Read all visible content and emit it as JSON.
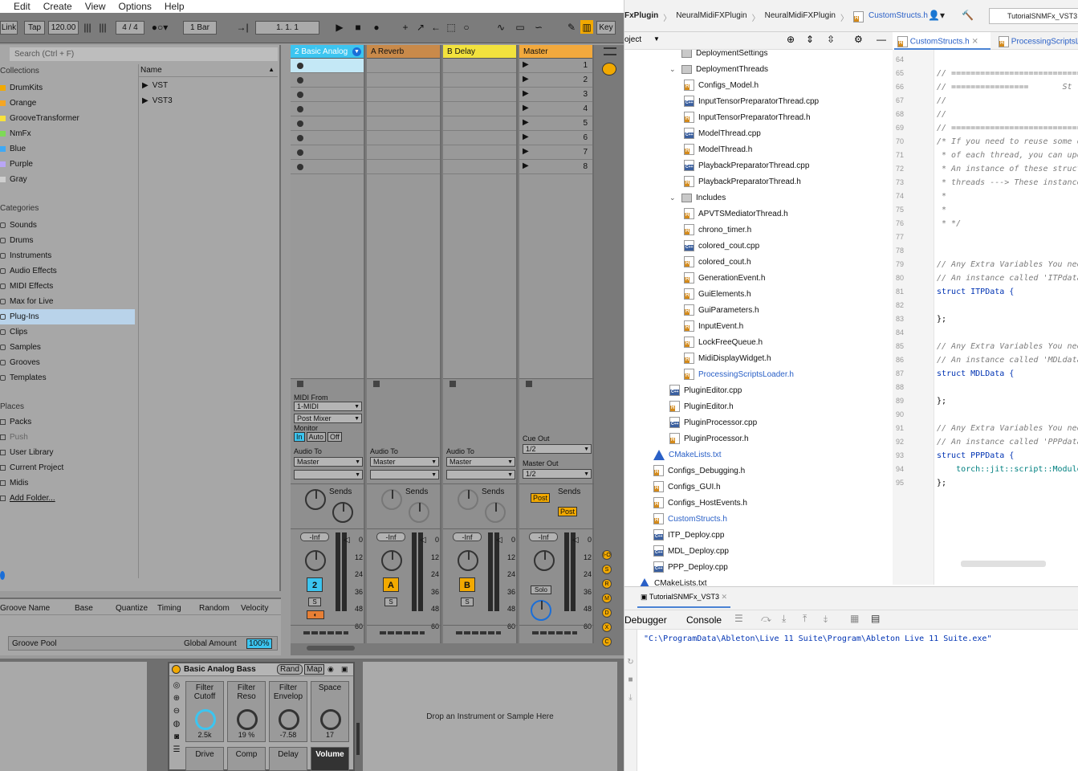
{
  "ableton": {
    "menu": [
      "Edit",
      "Create",
      "View",
      "Options",
      "Help"
    ],
    "transport": {
      "link": "Link",
      "tap": "Tap",
      "tempo": "120.00",
      "signature": "4 / 4",
      "quantize": "1 Bar",
      "position": "1.   1.   1",
      "key": "Key"
    },
    "browser": {
      "search_placeholder": "Search (Ctrl + F)",
      "collections_heading": "Collections",
      "collections": [
        {
          "label": "DrumKits",
          "color": "#f2a900"
        },
        {
          "label": "Orange",
          "color": "#f5a623"
        },
        {
          "label": "GrooveTransformer",
          "color": "#f7e13b"
        },
        {
          "label": "NmFx",
          "color": "#7ed957"
        },
        {
          "label": "Blue",
          "color": "#3fa9f5"
        },
        {
          "label": "Purple",
          "color": "#b9a6f5"
        },
        {
          "label": "Gray",
          "color": "#cfcfcf"
        }
      ],
      "categories_heading": "Categories",
      "categories": [
        "Sounds",
        "Drums",
        "Instruments",
        "Audio Effects",
        "MIDI Effects",
        "Max for Live",
        "Plug-Ins",
        "Clips",
        "Samples",
        "Grooves",
        "Templates"
      ],
      "places_heading": "Places",
      "places": [
        "Packs",
        "Push",
        "User Library",
        "Current Project",
        "Midis",
        "Add Folder..."
      ],
      "name_column": "Name",
      "name_items": [
        "VST",
        "VST3"
      ]
    },
    "groove": {
      "cols": [
        "Groove Name",
        "Base",
        "Quantize",
        "Timing",
        "Random",
        "Velocity"
      ],
      "pool": "Groove Pool",
      "global_amount_label": "Global Amount",
      "global_amount": "100%"
    },
    "tracks": [
      {
        "name": "2 Basic Analog",
        "color": "#3cc5f0",
        "number": "2",
        "send_a": "A",
        "send_b": "B",
        "vol": "-Inf"
      },
      {
        "name": "A Reverb",
        "color": "#c98a4a",
        "number": "A",
        "vol": "-Inf"
      },
      {
        "name": "B Delay",
        "color": "#f2e23d",
        "number": "B",
        "vol": "-Inf"
      },
      {
        "name": "Master",
        "color": "#f2a93d",
        "vol": "-Inf"
      }
    ],
    "scenes": [
      "1",
      "2",
      "3",
      "4",
      "5",
      "6",
      "7",
      "8"
    ],
    "io": {
      "midi_from": "MIDI From",
      "midi_from_val": "1-MIDI",
      "mixer_val": "Post Mixer",
      "monitor": "Monitor",
      "mon_in": "In",
      "mon_auto": "Auto",
      "mon_off": "Off",
      "audio_to": "Audio To",
      "master": "Master",
      "cue_out": "Cue Out",
      "cue_val": "1/2",
      "master_out": "Master Out",
      "master_out_val": "1/2"
    },
    "sends": "Sends",
    "post": "Post",
    "solo": "Solo",
    "s": "S",
    "meter_ticks": [
      "0",
      "12",
      "24",
      "36",
      "48",
      "60"
    ],
    "side_labels": [
      "I-O",
      "S",
      "R",
      "M",
      "D",
      "X",
      "C"
    ],
    "device": {
      "name": "Basic Analog Bass",
      "rand": "Rand",
      "map": "Map",
      "macros": [
        {
          "label": "Filter Cutoff",
          "value": "2.5k"
        },
        {
          "label": "Filter Reso",
          "value": "19 %"
        },
        {
          "label": "Filter Envelop",
          "value": "-7.58"
        },
        {
          "label": "Space",
          "value": "17"
        }
      ],
      "macros2": [
        "Drive",
        "Comp",
        "Delay",
        "Volume"
      ],
      "drop_text": "Drop an Instrument or Sample Here"
    }
  },
  "ide": {
    "breadcrumbs": [
      "FxPlugin",
      "NeuralMidiFXPlugin",
      "NeuralMidiFXPlugin",
      "CustomStructs.h"
    ],
    "run_config": "TutorialSNMFx_VST3",
    "project_label": "oject",
    "editor_tabs": [
      "CustomStructs.h",
      "ProcessingScriptsL"
    ],
    "tree": [
      {
        "label": "DeploymentSettings",
        "type": "folder",
        "depth": 2
      },
      {
        "label": "DeploymentThreads",
        "type": "folder",
        "depth": 2,
        "open": true
      },
      {
        "label": "Configs_Model.h",
        "type": "h",
        "depth": 3
      },
      {
        "label": "InputTensorPreparatorThread.cpp",
        "type": "c",
        "depth": 3
      },
      {
        "label": "InputTensorPreparatorThread.h",
        "type": "h",
        "depth": 3
      },
      {
        "label": "ModelThread.cpp",
        "type": "c",
        "depth": 3
      },
      {
        "label": "ModelThread.h",
        "type": "h",
        "depth": 3
      },
      {
        "label": "PlaybackPreparatorThread.cpp",
        "type": "c",
        "depth": 3
      },
      {
        "label": "PlaybackPreparatorThread.h",
        "type": "h",
        "depth": 3
      },
      {
        "label": "Includes",
        "type": "folder",
        "depth": 2,
        "open": true
      },
      {
        "label": "APVTSMediatorThread.h",
        "type": "h",
        "depth": 3
      },
      {
        "label": "chrono_timer.h",
        "type": "h",
        "depth": 3
      },
      {
        "label": "colored_cout.cpp",
        "type": "c",
        "depth": 3
      },
      {
        "label": "colored_cout.h",
        "type": "h",
        "depth": 3
      },
      {
        "label": "GenerationEvent.h",
        "type": "h",
        "depth": 3
      },
      {
        "label": "GuiElements.h",
        "type": "h",
        "depth": 3
      },
      {
        "label": "GuiParameters.h",
        "type": "h",
        "depth": 3
      },
      {
        "label": "InputEvent.h",
        "type": "h",
        "depth": 3
      },
      {
        "label": "LockFreeQueue.h",
        "type": "h",
        "depth": 3
      },
      {
        "label": "MidiDisplayWidget.h",
        "type": "h",
        "depth": 3
      },
      {
        "label": "ProcessingScriptsLoader.h",
        "type": "h",
        "depth": 3,
        "blue": true
      },
      {
        "label": "PluginEditor.cpp",
        "type": "c",
        "depth": 2
      },
      {
        "label": "PluginEditor.h",
        "type": "h",
        "depth": 2
      },
      {
        "label": "PluginProcessor.cpp",
        "type": "c",
        "depth": 2
      },
      {
        "label": "PluginProcessor.h",
        "type": "h",
        "depth": 2
      },
      {
        "label": "CMakeLists.txt",
        "type": "cmake",
        "depth": 1,
        "blue": true
      },
      {
        "label": "Configs_Debugging.h",
        "type": "h",
        "depth": 1
      },
      {
        "label": "Configs_GUI.h",
        "type": "h",
        "depth": 1
      },
      {
        "label": "Configs_HostEvents.h",
        "type": "h",
        "depth": 1
      },
      {
        "label": "CustomStructs.h",
        "type": "h",
        "depth": 1,
        "blue": true
      },
      {
        "label": "ITP_Deploy.cpp",
        "type": "c",
        "depth": 1
      },
      {
        "label": "MDL_Deploy.cpp",
        "type": "c",
        "depth": 1
      },
      {
        "label": "PPP_Deploy.cpp",
        "type": "c",
        "depth": 1
      },
      {
        "label": "CMakeLists.txt",
        "type": "cmake",
        "depth": 0
      }
    ],
    "lines": [
      {
        "n": "64",
        "t": "",
        "c": ""
      },
      {
        "n": "65",
        "t": "// ============================",
        "c": "cmt"
      },
      {
        "n": "66",
        "t": "// ================       St",
        "c": "cmt"
      },
      {
        "n": "67",
        "t": "//",
        "c": "cmt"
      },
      {
        "n": "68",
        "t": "//",
        "c": "cmt"
      },
      {
        "n": "69",
        "t": "// ============================",
        "c": "cmt"
      },
      {
        "n": "70",
        "t": "/* If you need to reuse some d",
        "c": "cmt"
      },
      {
        "n": "71",
        "t": " * of each thread, you can upd",
        "c": "cmt"
      },
      {
        "n": "72",
        "t": " * An instance of these struct",
        "c": "cmt"
      },
      {
        "n": "73",
        "t": " * threads ---> These instance",
        "c": "cmt"
      },
      {
        "n": "74",
        "t": " *",
        "c": "cmt"
      },
      {
        "n": "75",
        "t": " *",
        "c": "cmt"
      },
      {
        "n": "76",
        "t": " * */",
        "c": "cmt"
      },
      {
        "n": "77",
        "t": "",
        "c": ""
      },
      {
        "n": "78",
        "t": "",
        "c": ""
      },
      {
        "n": "79",
        "t": "// Any Extra Variables You nee",
        "c": "cmt"
      },
      {
        "n": "80",
        "t": "// An instance called 'ITPdata",
        "c": "cmt"
      },
      {
        "n": "81",
        "t": "struct ITPData {",
        "c": "kw"
      },
      {
        "n": "82",
        "t": "",
        "c": ""
      },
      {
        "n": "83",
        "t": "};",
        "c": ""
      },
      {
        "n": "84",
        "t": "",
        "c": ""
      },
      {
        "n": "85",
        "t": "// Any Extra Variables You nee",
        "c": "cmt"
      },
      {
        "n": "86",
        "t": "// An instance called 'MDLdata",
        "c": "cmt"
      },
      {
        "n": "87",
        "t": "struct MDLData {",
        "c": "kw"
      },
      {
        "n": "88",
        "t": "",
        "c": ""
      },
      {
        "n": "89",
        "t": "};",
        "c": ""
      },
      {
        "n": "90",
        "t": "",
        "c": ""
      },
      {
        "n": "91",
        "t": "// Any Extra Variables You nee",
        "c": "cmt"
      },
      {
        "n": "92",
        "t": "// An instance called 'PPPdata",
        "c": "cmt"
      },
      {
        "n": "93",
        "t": "struct PPPData {",
        "c": "kw"
      },
      {
        "n": "94",
        "t": "    torch::jit::script::Module",
        "c": "ty"
      },
      {
        "n": "95",
        "t": "};",
        "c": ""
      }
    ],
    "run_tab": "TutorialSNMFx_VST3",
    "debugger": "Debugger",
    "console_tab": "Console",
    "console_output": "\"C:\\ProgramData\\Ableton\\Live 11 Suite\\Program\\Ableton Live 11 Suite.exe\""
  }
}
